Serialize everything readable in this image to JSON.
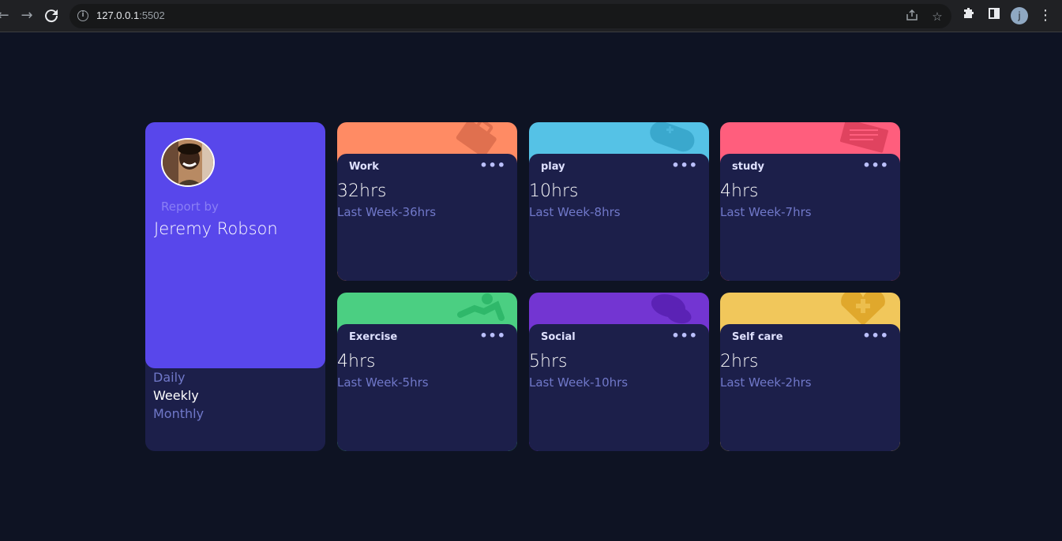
{
  "browser": {
    "url_host": "127.0.0.1",
    "url_port": ":5502",
    "profile_initial": "j"
  },
  "profile": {
    "report_by": "Report by",
    "name": "Jeremy Robson",
    "periods": [
      "Daily",
      "Weekly",
      "Monthly"
    ],
    "active_period": "Weekly"
  },
  "cards": [
    {
      "title": "Work",
      "hours": "32hrs",
      "last": "Last Week-36hrs",
      "color": "#ff8b64",
      "icon_color": "#e0704f",
      "icon": "briefcase-icon"
    },
    {
      "title": "play",
      "hours": "10hrs",
      "last": "Last Week-8hrs",
      "color": "#55c2e6",
      "icon_color": "#3aa8cd",
      "icon": "gamepad-icon"
    },
    {
      "title": "study",
      "hours": "4hrs",
      "last": "Last Week-7hrs",
      "color": "#ff5e7d",
      "icon_color": "#e0435f",
      "icon": "book-icon"
    },
    {
      "title": "Exercise",
      "hours": "4hrs",
      "last": "Last Week-5hrs",
      "color": "#4bcf82",
      "icon_color": "#2fb86a",
      "icon": "runner-icon"
    },
    {
      "title": "Social",
      "hours": "5hrs",
      "last": "Last Week-10hrs",
      "color": "#7335d2",
      "icon_color": "#5b22b5",
      "icon": "chat-icon"
    },
    {
      "title": "Self care",
      "hours": "2hrs",
      "last": "Last Week-2hrs",
      "color": "#f1c75b",
      "icon_color": "#e0a82c",
      "icon": "heart-icon"
    }
  ]
}
